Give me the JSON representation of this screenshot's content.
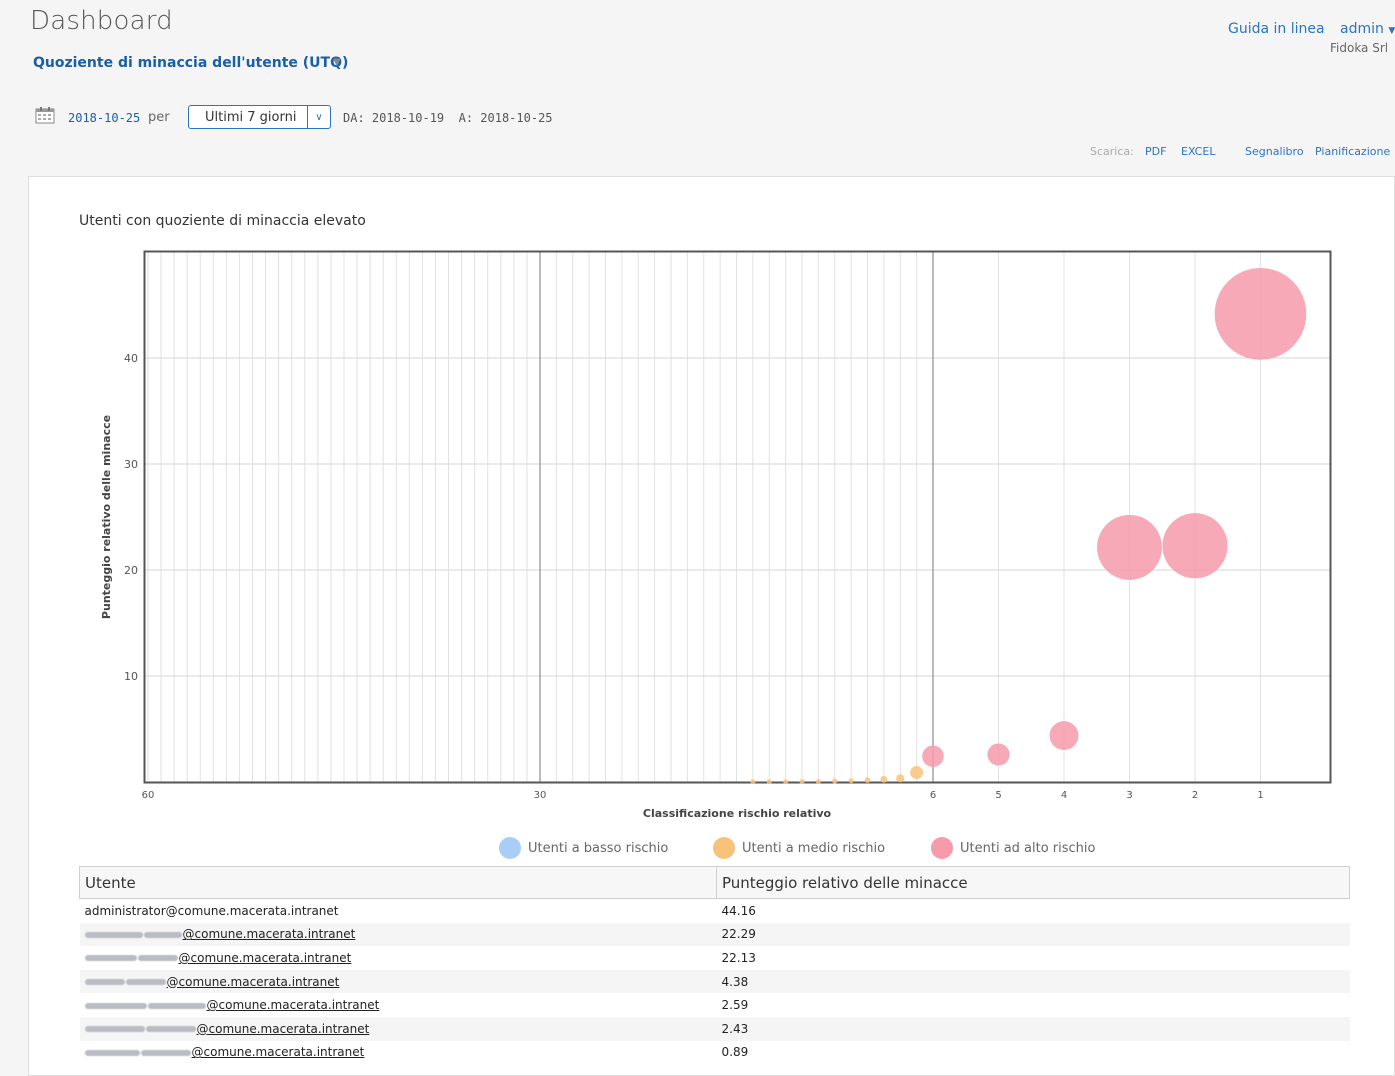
{
  "header": {
    "title": "Dashboard",
    "report_name": "Quoziente di minaccia dell'utente (UTQ)",
    "help_label": "Guida in linea",
    "user_label": "admin",
    "org_label": "Fidoka Srl"
  },
  "filters": {
    "date": "2018-10-25",
    "per_label": "per",
    "period": "Ultimi 7 giorni",
    "range_from_label": "DA: 2018-10-19",
    "range_to_label": "A: 2018-10-25"
  },
  "actions": {
    "download_label": "Scarica:",
    "pdf": "PDF",
    "excel": "EXCEL",
    "bookmark": "Segnalibro",
    "schedule": "Pianificazione"
  },
  "chart_data": {
    "type": "scatter",
    "title": "Utenti con quoziente di minaccia elevato",
    "xlabel": "Classificazione rischio relativo",
    "ylabel": "Punteggio relativo delle minacce",
    "x_ticks": [
      "60",
      "30",
      "6",
      "5",
      "4",
      "3",
      "2",
      "1"
    ],
    "y_ticks": [
      "10",
      "20",
      "30",
      "40"
    ],
    "ylim": [
      0,
      50
    ],
    "grid": true,
    "legend_position": "bottom",
    "series": [
      {
        "name": "Utenti a basso rischio",
        "color": "#a9cdf5",
        "points": []
      },
      {
        "name": "Utenti a medio rischio",
        "color": "#f9c27a",
        "points": [
          {
            "rank": 7,
            "value": 0.89
          },
          {
            "rank": 8,
            "value": 0.35
          },
          {
            "rank": 9,
            "value": 0.25
          },
          {
            "rank": 10,
            "value": 0.18
          },
          {
            "rank": 11,
            "value": 0.12
          },
          {
            "rank": 12,
            "value": 0.08
          },
          {
            "rank": 13,
            "value": 0.05
          },
          {
            "rank": 14,
            "value": 0.04
          },
          {
            "rank": 15,
            "value": 0.03
          },
          {
            "rank": 16,
            "value": 0.02
          },
          {
            "rank": 17,
            "value": 0.02
          }
        ]
      },
      {
        "name": "Utenti ad alto rischio",
        "color": "#f79aab",
        "points": [
          {
            "rank": 1,
            "value": 44.16
          },
          {
            "rank": 2,
            "value": 22.29
          },
          {
            "rank": 3,
            "value": 22.13
          },
          {
            "rank": 4,
            "value": 4.38
          },
          {
            "rank": 5,
            "value": 2.59
          },
          {
            "rank": 6,
            "value": 2.43
          }
        ]
      }
    ]
  },
  "legend": [
    {
      "label": "Utenti a basso rischio",
      "color": "#a9cdf5"
    },
    {
      "label": "Utenti a medio rischio",
      "color": "#f9c27a"
    },
    {
      "label": "Utenti ad alto rischio",
      "color": "#f79aab"
    }
  ],
  "table": {
    "headers": [
      "Utente",
      "Punteggio relativo delle minacce"
    ],
    "rows": [
      {
        "user": "administrator@comune.macerata.intranet",
        "score": "44.16"
      },
      {
        "user": "@comune.macerata.intranet",
        "score": "22.29"
      },
      {
        "user": "@comune.macerata.intranet",
        "score": "22.13"
      },
      {
        "user": "@comune.macerata.intranet",
        "score": "4.38"
      },
      {
        "user": "@comune.macerata.intranet",
        "score": "2.59"
      },
      {
        "user": "@comune.macerata.intranet",
        "score": "2.43"
      },
      {
        "user": "@comune.macerata.intranet",
        "score": "0.89"
      }
    ]
  }
}
